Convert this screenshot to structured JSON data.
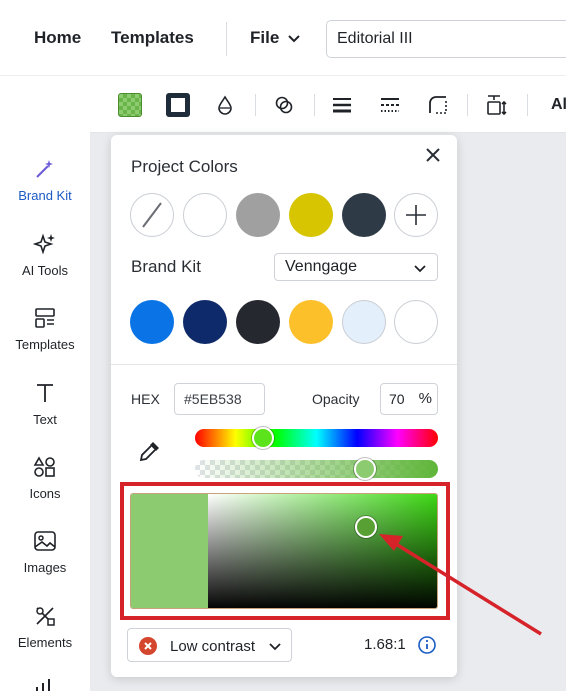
{
  "header": {
    "nav": [
      "Home",
      "Templates"
    ],
    "file_label": "File",
    "doc_title": "Editorial III"
  },
  "sidebar": {
    "items": [
      {
        "label": "Brand Kit",
        "icon": "magic-wand-icon",
        "active": true
      },
      {
        "label": "AI Tools",
        "icon": "sparkles-icon"
      },
      {
        "label": "Templates",
        "icon": "templates-icon"
      },
      {
        "label": "Text",
        "icon": "text-icon"
      },
      {
        "label": "Icons",
        "icon": "shapes-icon"
      },
      {
        "label": "Images",
        "icon": "image-icon"
      },
      {
        "label": "Elements",
        "icon": "elements-icon"
      }
    ]
  },
  "toolbar": {
    "partial_label": "Al",
    "icons": [
      "fill-color-icon",
      "border-color-icon",
      "opacity-drop-icon",
      "mask-icon",
      "line-weight-icon",
      "line-style-icon",
      "corner-radius-icon",
      "resize-icon"
    ]
  },
  "popover": {
    "project_colors_title": "Project Colors",
    "project_colors": [
      "none",
      "#ffffff",
      "#a0a0a0",
      "#d6c500",
      "#2e3a46",
      "add"
    ],
    "brand_kit_label": "Brand Kit",
    "brand_kit_selected": "Venngage",
    "brand_colors": [
      "#0a74e6",
      "#0f2a6b",
      "#262830",
      "#fcc02b",
      "#e4effc",
      "#ffffff"
    ],
    "hex_label": "HEX",
    "hex_value": "#5EB538",
    "opacity_label": "Opacity",
    "opacity_value": "70",
    "opacity_unit": "%",
    "current_color": "#5EB538",
    "contrast_label": "Low contrast",
    "contrast_ratio": "1.68:1"
  },
  "colors": {
    "accent": "#1a5bc4",
    "highlight_red": "#d6232a"
  }
}
